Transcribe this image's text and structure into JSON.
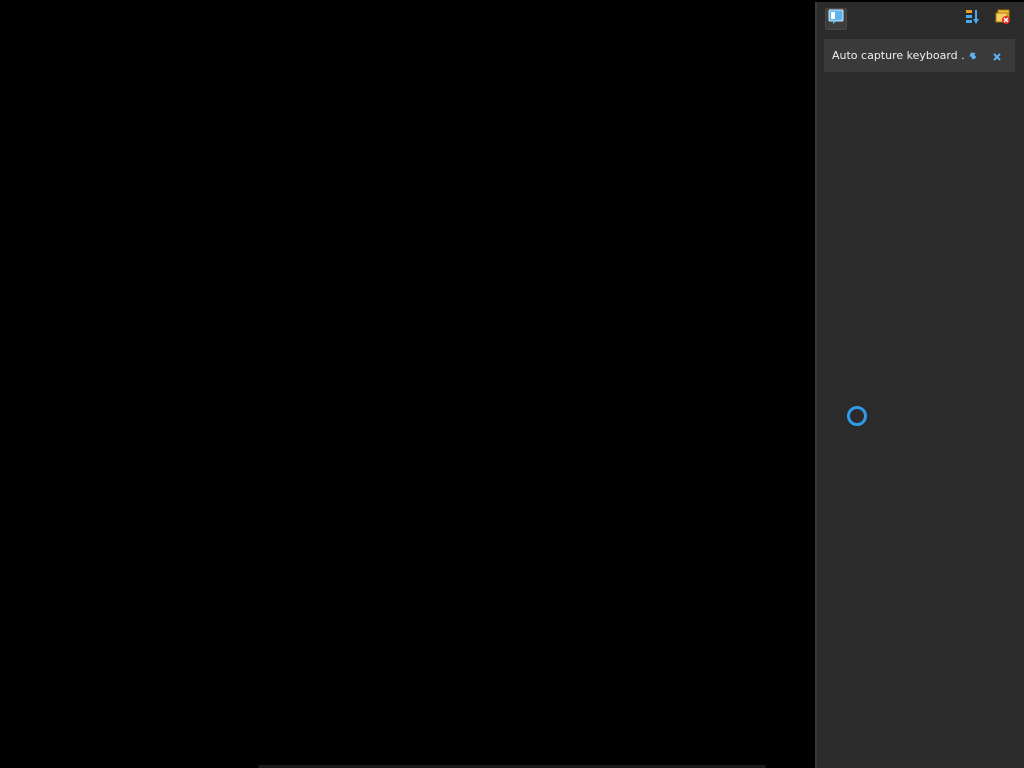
{
  "notification_panel": {
    "toolbar": {
      "notifications_icon": "notifications-icon",
      "sort_icon": "sort-icon",
      "clear_all_icon": "clear-all-icon"
    },
    "notifications": [
      {
        "text": "Auto capture keyboard ...",
        "pin_icon": "pin-icon",
        "close_icon": "close-icon"
      }
    ]
  },
  "colors": {
    "display_background": "#000000",
    "panel_background": "#2b2b2b",
    "notification_background": "#3a3a3a",
    "accent": "#2f9be8"
  },
  "cursor": {
    "state": "busy",
    "icon": "busy-spinner-icon"
  }
}
